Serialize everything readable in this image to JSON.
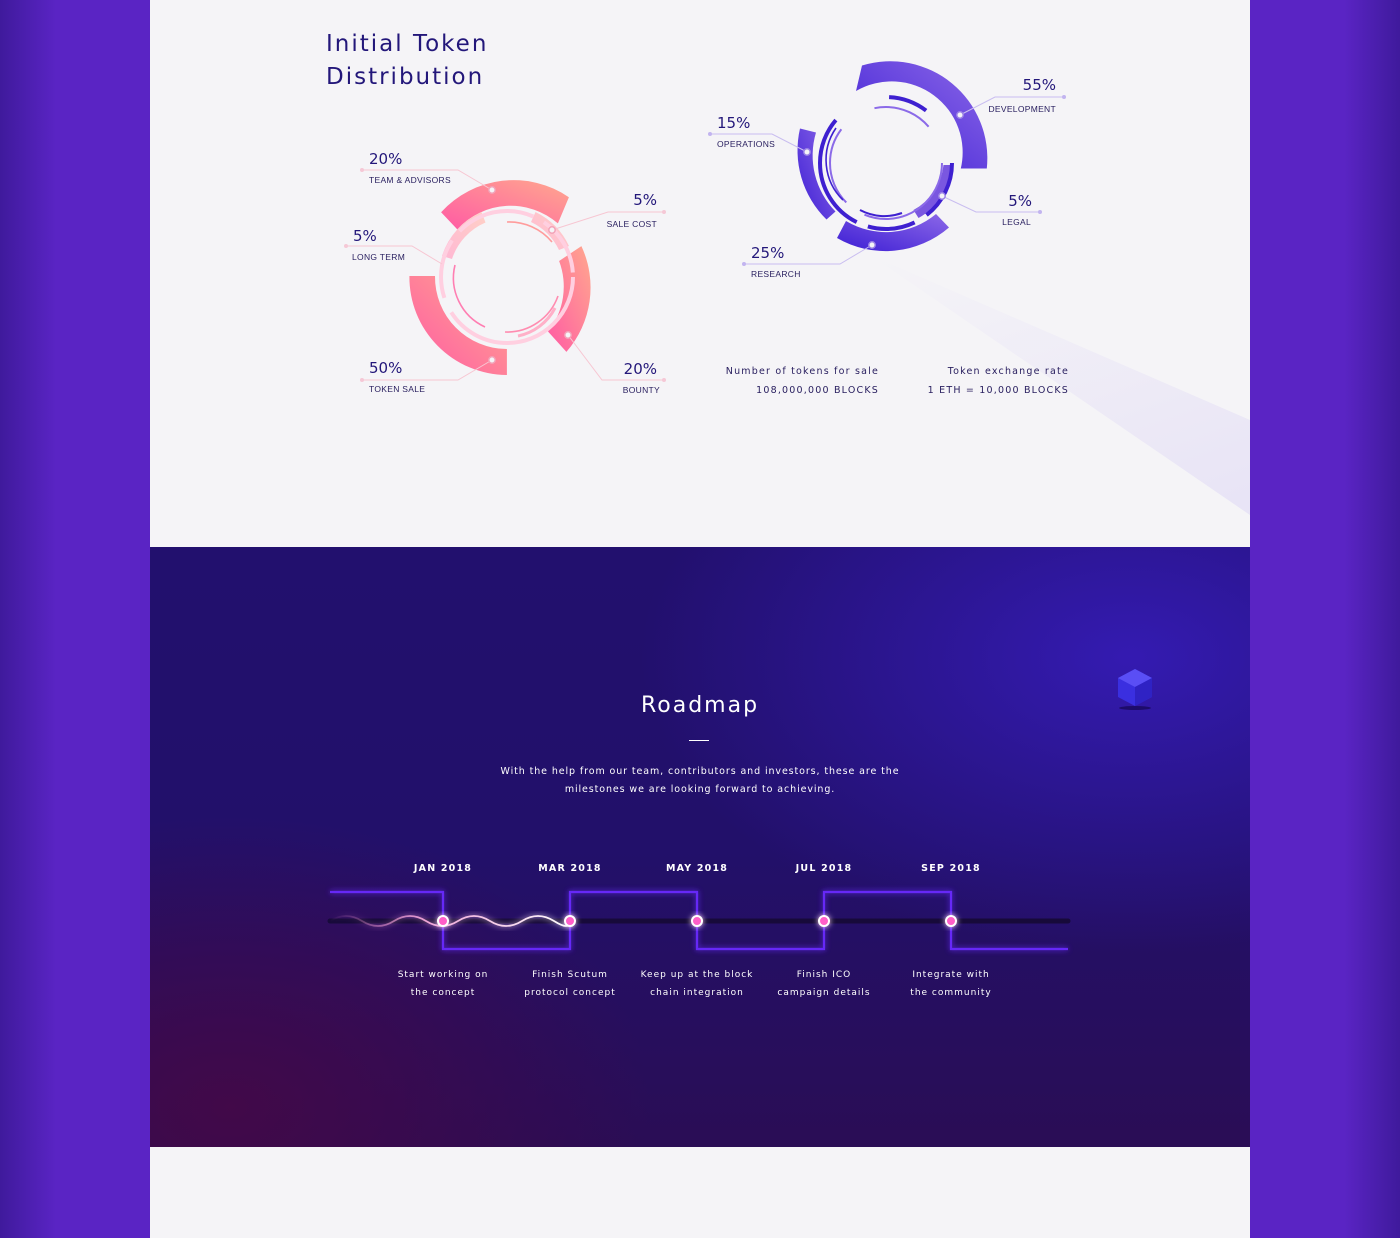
{
  "distribution": {
    "title_line1": "Initial Token",
    "title_line2": "Distribution",
    "left_chart": [
      {
        "percent": "20%",
        "label": "TEAM & ADVISORS"
      },
      {
        "percent": "5%",
        "label": "SALE COST"
      },
      {
        "percent": "5%",
        "label": "LONG TERM"
      },
      {
        "percent": "50%",
        "label": "TOKEN SALE"
      },
      {
        "percent": "20%",
        "label": "BOUNTY"
      }
    ],
    "right_chart": [
      {
        "percent": "55%",
        "label": "DEVELOPMENT"
      },
      {
        "percent": "15%",
        "label": "OPERATIONS"
      },
      {
        "percent": "5%",
        "label": "LEGAL"
      },
      {
        "percent": "25%",
        "label": "RESEARCH"
      }
    ],
    "tokens_for_sale_label": "Number of tokens for sale",
    "tokens_for_sale_value": "108,000,000 BLOCKS",
    "exchange_rate_label": "Token exchange rate",
    "exchange_rate_value": "1 ETH = 10,000 BLOCKS",
    "colors": {
      "heading": "#23177a",
      "pink_start": "#ff6ea8",
      "pink_end": "#ffa08e",
      "purple_start": "#3f20d6",
      "purple_end": "#8a62e6"
    }
  },
  "chart_data": [
    {
      "type": "pie",
      "categories": [
        "TEAM & ADVISORS",
        "SALE COST",
        "LONG TERM",
        "TOKEN SALE",
        "BOUNTY"
      ],
      "values": [
        20,
        5,
        5,
        50,
        20
      ]
    },
    {
      "type": "pie",
      "categories": [
        "DEVELOPMENT",
        "OPERATIONS",
        "LEGAL",
        "RESEARCH"
      ],
      "values": [
        55,
        15,
        5,
        25
      ]
    }
  ],
  "roadmap": {
    "title": "Roadmap",
    "description_line1": "With the help from our team, contributors and investors, these are the",
    "description_line2": "milestones we are looking forward to achieving.",
    "milestones": [
      {
        "date": "JAN 2018",
        "line1": "Start working on",
        "line2": "the concept"
      },
      {
        "date": "MAR 2018",
        "line1": "Finish Scutum",
        "line2": "protocol concept"
      },
      {
        "date": "MAY 2018",
        "line1": "Keep up at the block",
        "line2": "chain integration"
      },
      {
        "date": "JUL 2018",
        "line1": "Finish ICO",
        "line2": "campaign details"
      },
      {
        "date": "SEP 2018",
        "line1": "Integrate with",
        "line2": "the community"
      }
    ],
    "colors": {
      "accent": "#ff5fc8",
      "line": "#6a2cff"
    }
  }
}
